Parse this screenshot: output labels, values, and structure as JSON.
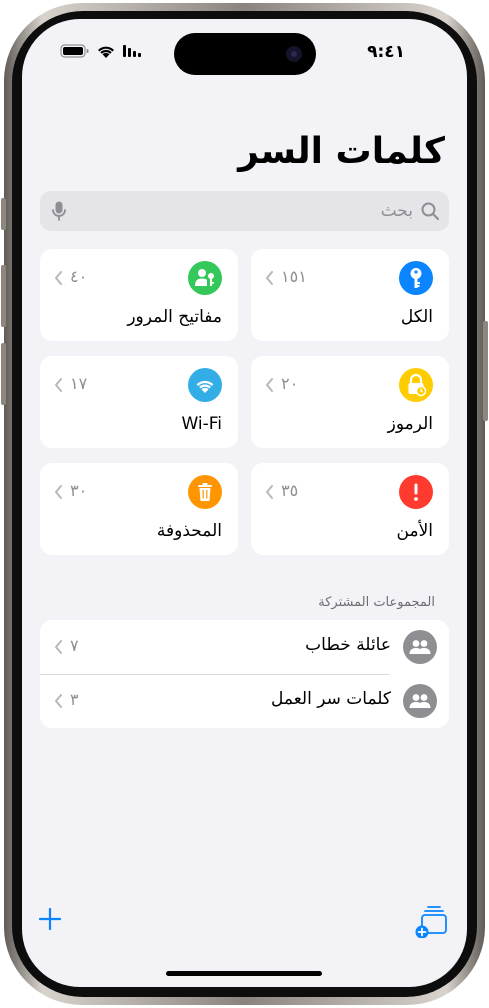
{
  "status_bar": {
    "time": "٩:٤١"
  },
  "header": {
    "title": "كلمات السر"
  },
  "search": {
    "placeholder": "بحث"
  },
  "categories": [
    {
      "label": "الكل",
      "count": "١٥١",
      "icon": "key-icon",
      "color": "#0a84ff"
    },
    {
      "label": "مفاتيح المرور",
      "count": "٤٠",
      "icon": "passkey-icon",
      "color": "#34c759"
    },
    {
      "label": "الرموز",
      "count": "٢٠",
      "icon": "lock-clock-icon",
      "color": "#ffcc00"
    },
    {
      "label": "Wi-Fi",
      "count": "١٧",
      "icon": "wifi-icon",
      "color": "#32ade6"
    },
    {
      "label": "الأمن",
      "count": "٣٥",
      "icon": "exclamation-icon",
      "color": "#ff3b30"
    },
    {
      "label": "المحذوفة",
      "count": "٣٠",
      "icon": "trash-icon",
      "color": "#ff9500"
    }
  ],
  "shared_groups": {
    "title": "المجموعات المشتركة",
    "items": [
      {
        "label": "عائلة خطاب",
        "count": "٧",
        "icon": "people-icon"
      },
      {
        "label": "كلمات سر العمل",
        "count": "٣",
        "icon": "people-icon"
      }
    ]
  },
  "toolbar": {
    "add_icon": "plus-icon",
    "new_group_icon": "new-group-icon"
  },
  "colors": {
    "accent": "#0a84ff",
    "background": "#f2f2f7",
    "secondary_text": "#8e8e93"
  }
}
